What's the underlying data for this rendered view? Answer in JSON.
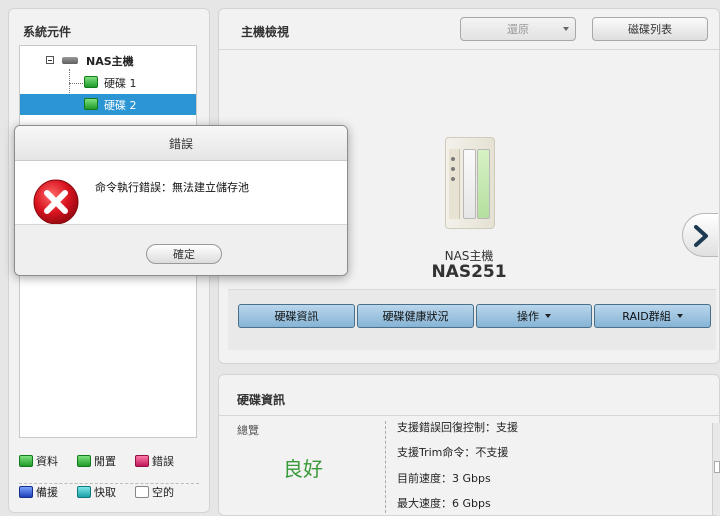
{
  "left_panel": {
    "title": "系統元件",
    "tree": {
      "root_label": "NAS主機",
      "items": [
        {
          "label": "硬碟 1"
        },
        {
          "label": "硬碟 2"
        }
      ]
    },
    "legend": [
      {
        "label": "資料",
        "icon": "disk-data-icon"
      },
      {
        "label": "閒置",
        "icon": "disk-idle-icon"
      },
      {
        "label": "錯誤",
        "icon": "disk-error-icon"
      },
      {
        "label": "備援",
        "icon": "disk-spare-icon"
      },
      {
        "label": "快取",
        "icon": "disk-cache-icon"
      },
      {
        "label": "空的",
        "icon": "disk-empty-icon"
      }
    ]
  },
  "main_panel": {
    "title": "主機檢視",
    "restore_label": "還原",
    "disk_list_label": "磁碟列表",
    "nas_label": "NAS主機",
    "nas_model": "NAS251",
    "tabs": [
      {
        "label": "硬碟資訊"
      },
      {
        "label": "硬碟健康狀況"
      },
      {
        "label": "操作"
      },
      {
        "label": "RAID群組"
      }
    ]
  },
  "info_panel": {
    "title": "硬碟資訊",
    "overview_label": "總覽",
    "overview_value": "良好",
    "lines": [
      "支援錯誤回復控制：支援",
      "支援Trim命令：不支援",
      "目前速度：3 Gbps",
      "最大速度：6 Gbps"
    ]
  },
  "dialog": {
    "title": "錯誤",
    "message": "命令執行錯誤：無法建立儲存池",
    "ok_label": "確定"
  },
  "colors": {
    "selected_row": "#2c95d3",
    "tab_button": "#9fc4e2",
    "good_status": "#3a9a3a",
    "error_icon": "#d8141f"
  }
}
